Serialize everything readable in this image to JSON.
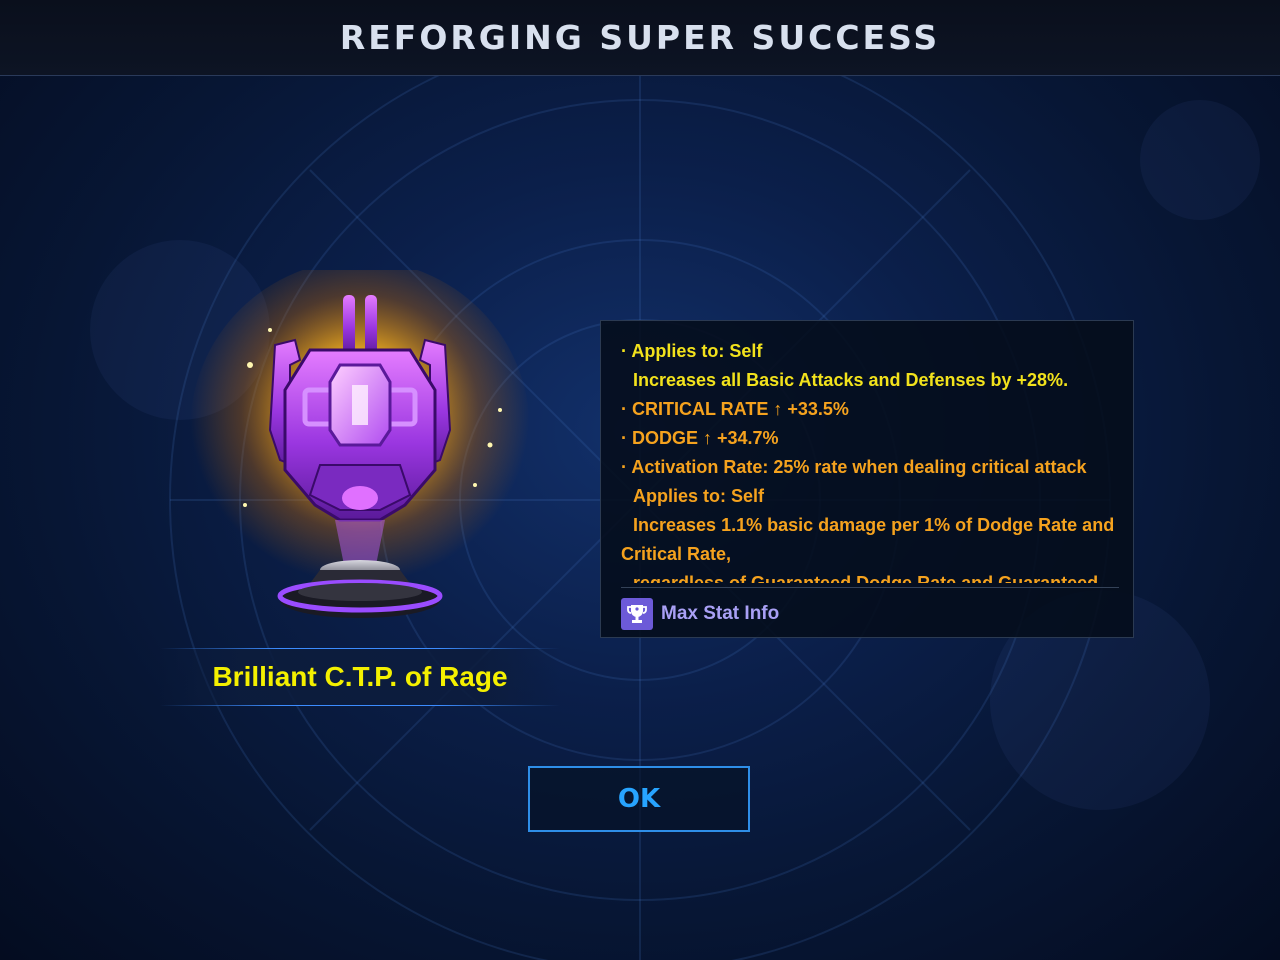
{
  "header": {
    "title": "REFORGING SUPER SUCCESS"
  },
  "item": {
    "name": "Brilliant C.T.P. of Rage",
    "icon": "ctp-rage-trophy-icon"
  },
  "stats": {
    "lines": [
      {
        "text": "· Applies to: Self",
        "color": "yellow"
      },
      {
        "text": "Increases all Basic Attacks and Defenses by +28%.",
        "color": "yellow"
      },
      {
        "text": "· CRITICAL RATE ↑ +33.5%",
        "color": "orange"
      },
      {
        "text": "· DODGE ↑ +34.7%",
        "color": "orange"
      },
      {
        "text": "· Activation Rate: 25% rate when dealing critical attack",
        "color": "orange"
      },
      {
        "text": "Applies to: Self",
        "color": "orange"
      },
      {
        "text": "Increases 1.1% basic damage per 1% of Dodge Rate and Critical Rate,",
        "color": "orange"
      },
      {
        "text": "regardless of Guaranteed Dodge Rate and Guaranteed",
        "color": "orange"
      }
    ],
    "max_stat_label": "Max Stat Info",
    "max_stat_icon": "trophy-icon"
  },
  "ok_button": {
    "label": "OK"
  },
  "colors": {
    "yellow": "#f2e21c",
    "orange": "#f5a21e",
    "accent": "#27a4ff",
    "max_stat": "#a9a0f5"
  }
}
